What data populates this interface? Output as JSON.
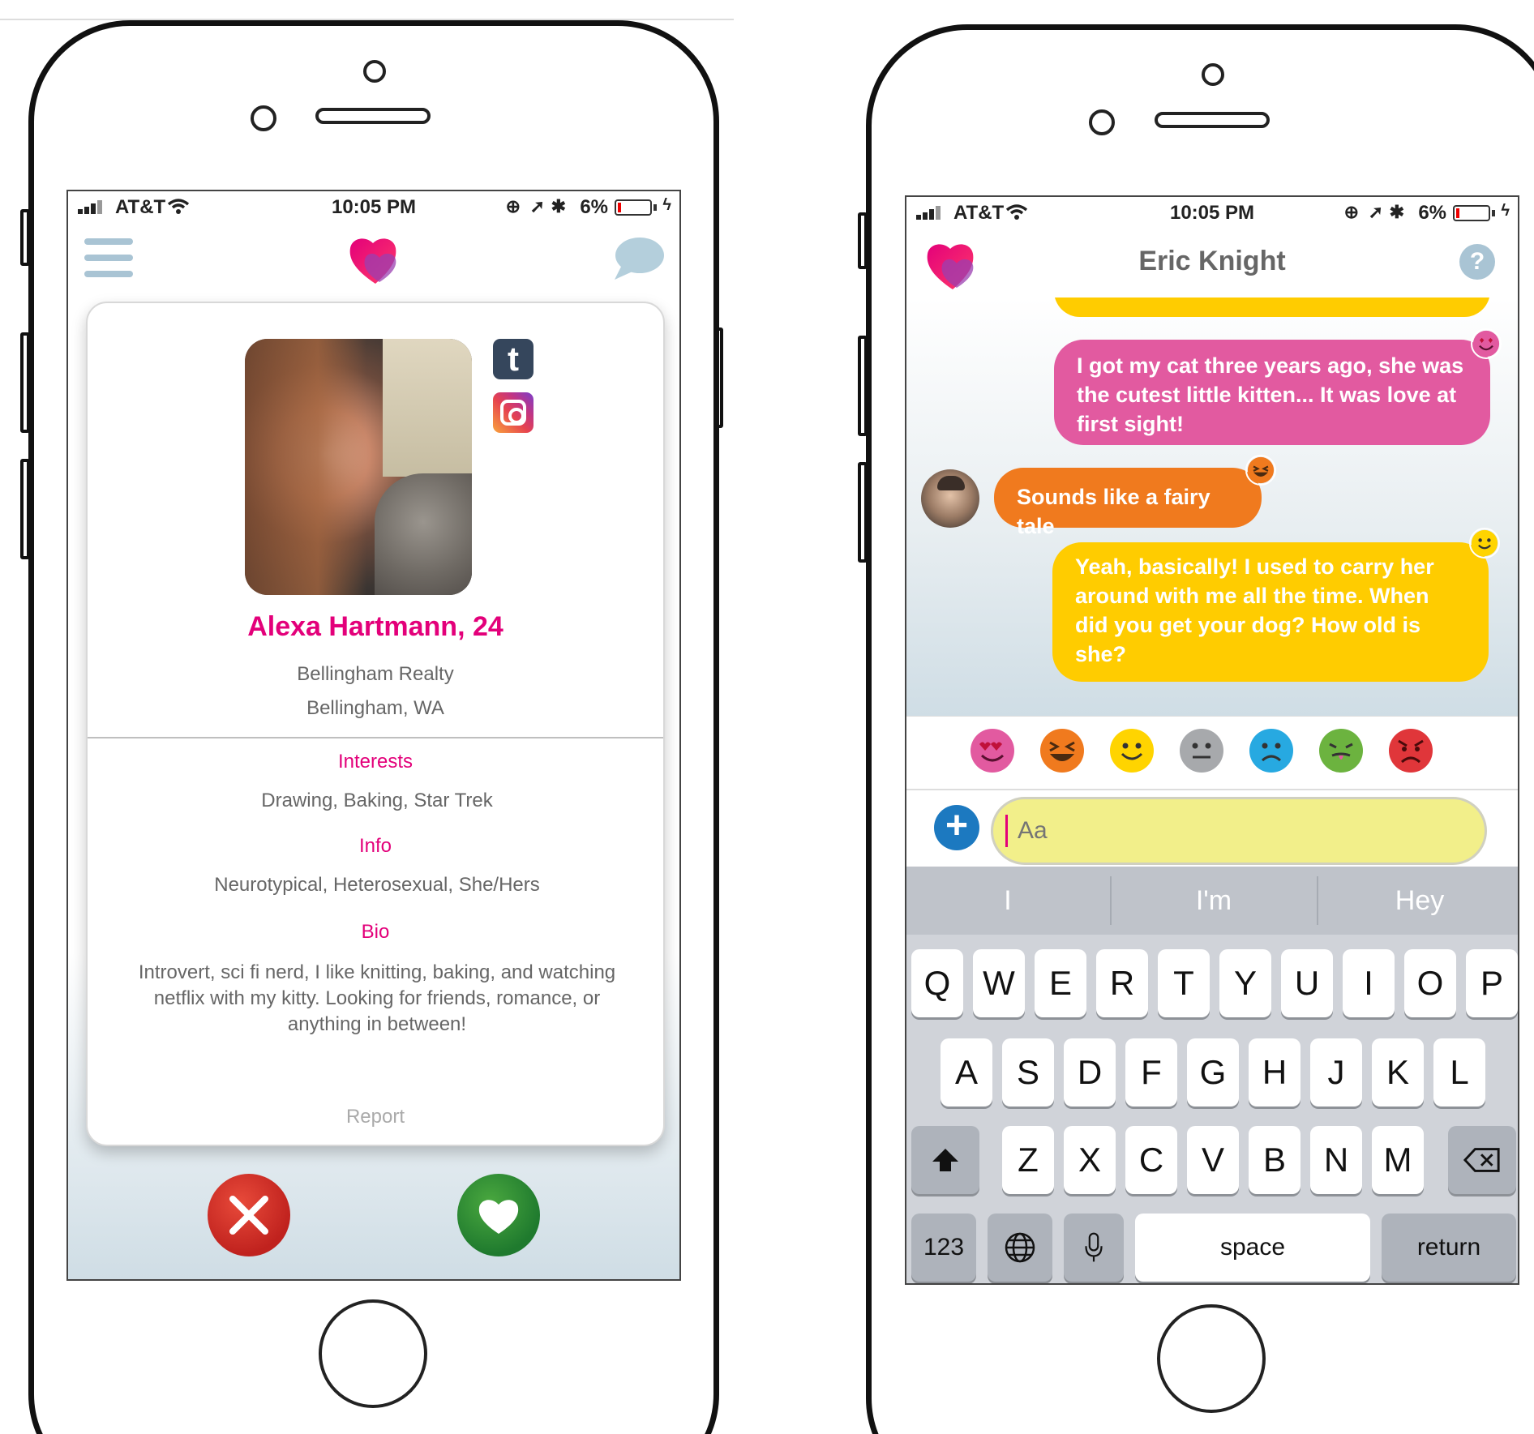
{
  "status_bar": {
    "carrier": "AT&T",
    "time": "10:05 PM",
    "battery": "6%"
  },
  "profile_screen": {
    "menu_icon": "hamburger-menu-icon",
    "logo_icon": "heart-logo-icon",
    "chat_icon": "speech-bubble-icon",
    "social_links": [
      {
        "name": "tumblr",
        "glyph": "t"
      },
      {
        "name": "instagram",
        "glyph": ""
      }
    ],
    "name_age": "Alexa Hartmann, 24",
    "workplace": "Bellingham Realty",
    "location": "Bellingham, WA",
    "sections": [
      {
        "title": "Interests",
        "value": "Drawing, Baking, Star Trek"
      },
      {
        "title": "Info",
        "value": "Neurotypical, Heterosexual, She/Hers"
      },
      {
        "title": "Bio",
        "value": "Introvert, sci fi nerd, I like knitting, baking, and watching netflix with my kitty. Looking for friends, romance, or anything in between!"
      }
    ],
    "report_label": "Report",
    "reject_icon": "x-icon",
    "like_icon": "heart-icon",
    "colors": {
      "accent": "#e3007a",
      "reject": "#c0221e",
      "like": "#1f7a2e"
    }
  },
  "chat_screen": {
    "contact_name": "Eric Knight",
    "help_glyph": "?",
    "messages": [
      {
        "from": "me",
        "text": "I got my cat three years ago, she was the cutest little kitten... It was love at first sight!",
        "color": "#e25aa0",
        "reaction": "heart-eyes"
      },
      {
        "from": "them",
        "text": "Sounds like a fairy tale",
        "color": "#f07a1e",
        "reaction": "laughing"
      },
      {
        "from": "me",
        "text": "Yeah, basically! I used to carry her around with me all the time. When did you get your dog? How old is she?",
        "color": "#ffcc00",
        "reaction": "smile"
      }
    ],
    "reactions": [
      {
        "name": "heart-eyes",
        "color": "#e25aa0"
      },
      {
        "name": "laughing",
        "color": "#f07a1e"
      },
      {
        "name": "smile",
        "color": "#ffd400"
      },
      {
        "name": "neutral",
        "color": "#a7a9ac"
      },
      {
        "name": "sad",
        "color": "#27a9e1"
      },
      {
        "name": "sick",
        "color": "#6cb33f"
      },
      {
        "name": "angry",
        "color": "#e0363a"
      }
    ],
    "input_placeholder": "Aa",
    "suggestions": [
      "I",
      "I'm",
      "Hey"
    ],
    "keyboard": {
      "row1": [
        "Q",
        "W",
        "E",
        "R",
        "T",
        "Y",
        "U",
        "I",
        "O",
        "P"
      ],
      "row2": [
        "A",
        "S",
        "D",
        "F",
        "G",
        "H",
        "J",
        "K",
        "L"
      ],
      "row3": [
        "Z",
        "X",
        "C",
        "V",
        "B",
        "N",
        "M"
      ],
      "numbers_label": "123",
      "space_label": "space",
      "return_label": "return"
    }
  }
}
